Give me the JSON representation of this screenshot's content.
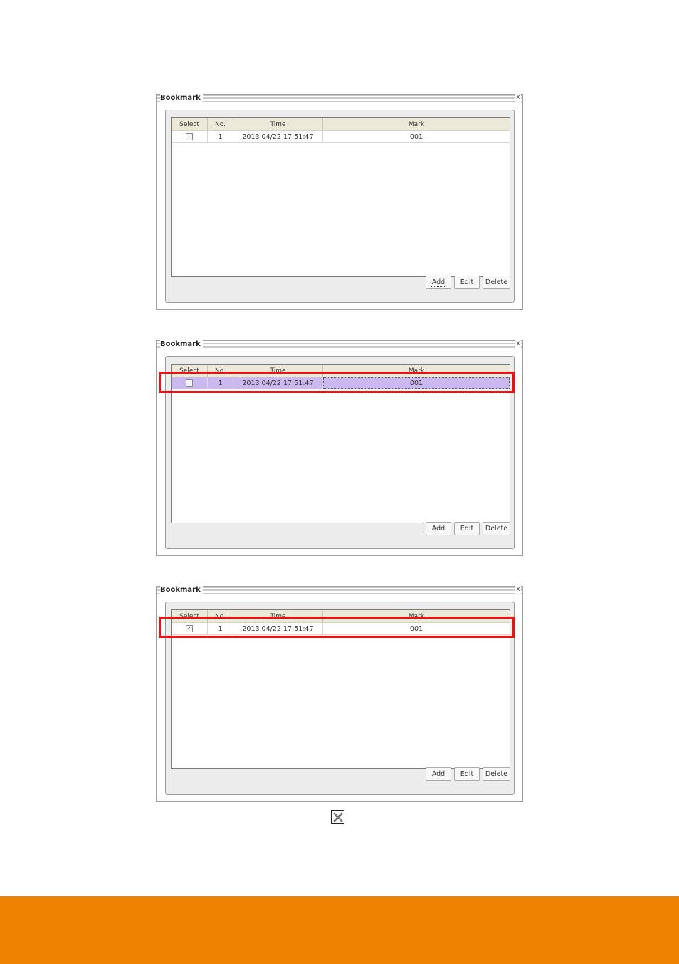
{
  "dialogs": [
    {
      "title": "Bookmark",
      "columns": [
        "Select",
        "No.",
        "Time",
        "Mark"
      ],
      "rows": [
        {
          "selected": false,
          "checked": false,
          "no": "1",
          "time": "2013 04/22  17:51:47",
          "mark": "001"
        }
      ],
      "buttons": {
        "add": "Add",
        "edit": "Edit",
        "delete": "Delete"
      },
      "focused_button": "add",
      "highlight": false
    },
    {
      "title": "Bookmark",
      "columns": [
        "Select",
        "No.",
        "Time",
        "Mark"
      ],
      "rows": [
        {
          "selected": true,
          "checked": false,
          "no": "1",
          "time": "2013 04/22  17:51:47",
          "mark": "001"
        }
      ],
      "buttons": {
        "add": "Add",
        "edit": "Edit",
        "delete": "Delete"
      },
      "focused_button": "",
      "highlight": true
    },
    {
      "title": "Bookmark",
      "columns": [
        "Select",
        "No.",
        "Time",
        "Mark"
      ],
      "rows": [
        {
          "selected": false,
          "checked": true,
          "no": "1",
          "time": "2013 04/22  17:51:47",
          "mark": "001"
        }
      ],
      "buttons": {
        "add": "Add",
        "edit": "Edit",
        "delete": "Delete"
      },
      "focused_button": "",
      "highlight": true
    }
  ],
  "close_symbol": "x",
  "checkmark_symbol": "✓",
  "inline_icon": "close-box-icon",
  "colors": {
    "footer": "#ef8200",
    "highlight": "#ee1111",
    "selected_row": "#cbb8f0"
  }
}
